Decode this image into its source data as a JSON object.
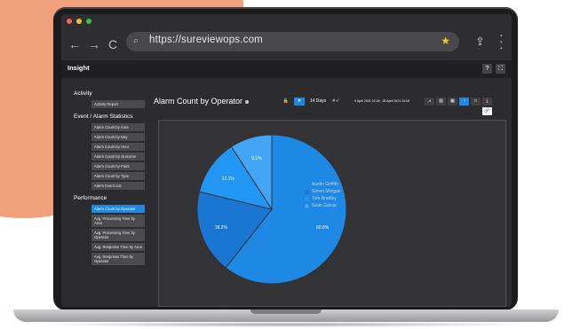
{
  "browser": {
    "url": "https://sureviewops.com",
    "nav": {
      "back": "←",
      "forward": "→",
      "reload": "C"
    }
  },
  "app": {
    "title": "Insight",
    "help_label": "?",
    "expand_label": "⛶"
  },
  "sidebar": {
    "sections": [
      {
        "title": "Activity",
        "items": [
          "Activity Report"
        ]
      },
      {
        "title": "Event / Alarm Statistics",
        "items": [
          "Alarm Count by Area",
          "Alarm Count by Day",
          "Alarm Count by Hour",
          "Alarm Count by Outcome",
          "Alarm Count by Point",
          "Alarm Count by Type",
          "Alarm Event List"
        ]
      },
      {
        "title": "Performance",
        "items": [
          "Alarm Count by Operator",
          "Avg. Processing Time by Area",
          "Avg. Processing Time by Operator",
          "Avg. Response Time by Area",
          "Avg. Response Time by Operator"
        ]
      }
    ],
    "active_item": "Alarm Count by Operator"
  },
  "report": {
    "title": "Alarm Count by Operator",
    "toolbar": {
      "range_label": "14 Days",
      "clear_label": "✕✓",
      "date_range": "9 April 2021 10:18 - 25 April 2021 10:18"
    }
  },
  "colors": {
    "accent": "#1e88e5",
    "slices": [
      "#1e88e5",
      "#1976d2",
      "#2196f3",
      "#42a5f5"
    ]
  },
  "chart_data": {
    "type": "pie",
    "title": "",
    "categories": [
      "Austin Griffith",
      "Simon Morgan",
      "Tom Bradley",
      "Sean Garcia"
    ],
    "values": [
      60.6,
      18.2,
      12.1,
      9.1
    ],
    "labels": [
      "60.6%",
      "18.2%",
      "12.1%",
      "9.1%"
    ],
    "legend_position": "right"
  }
}
